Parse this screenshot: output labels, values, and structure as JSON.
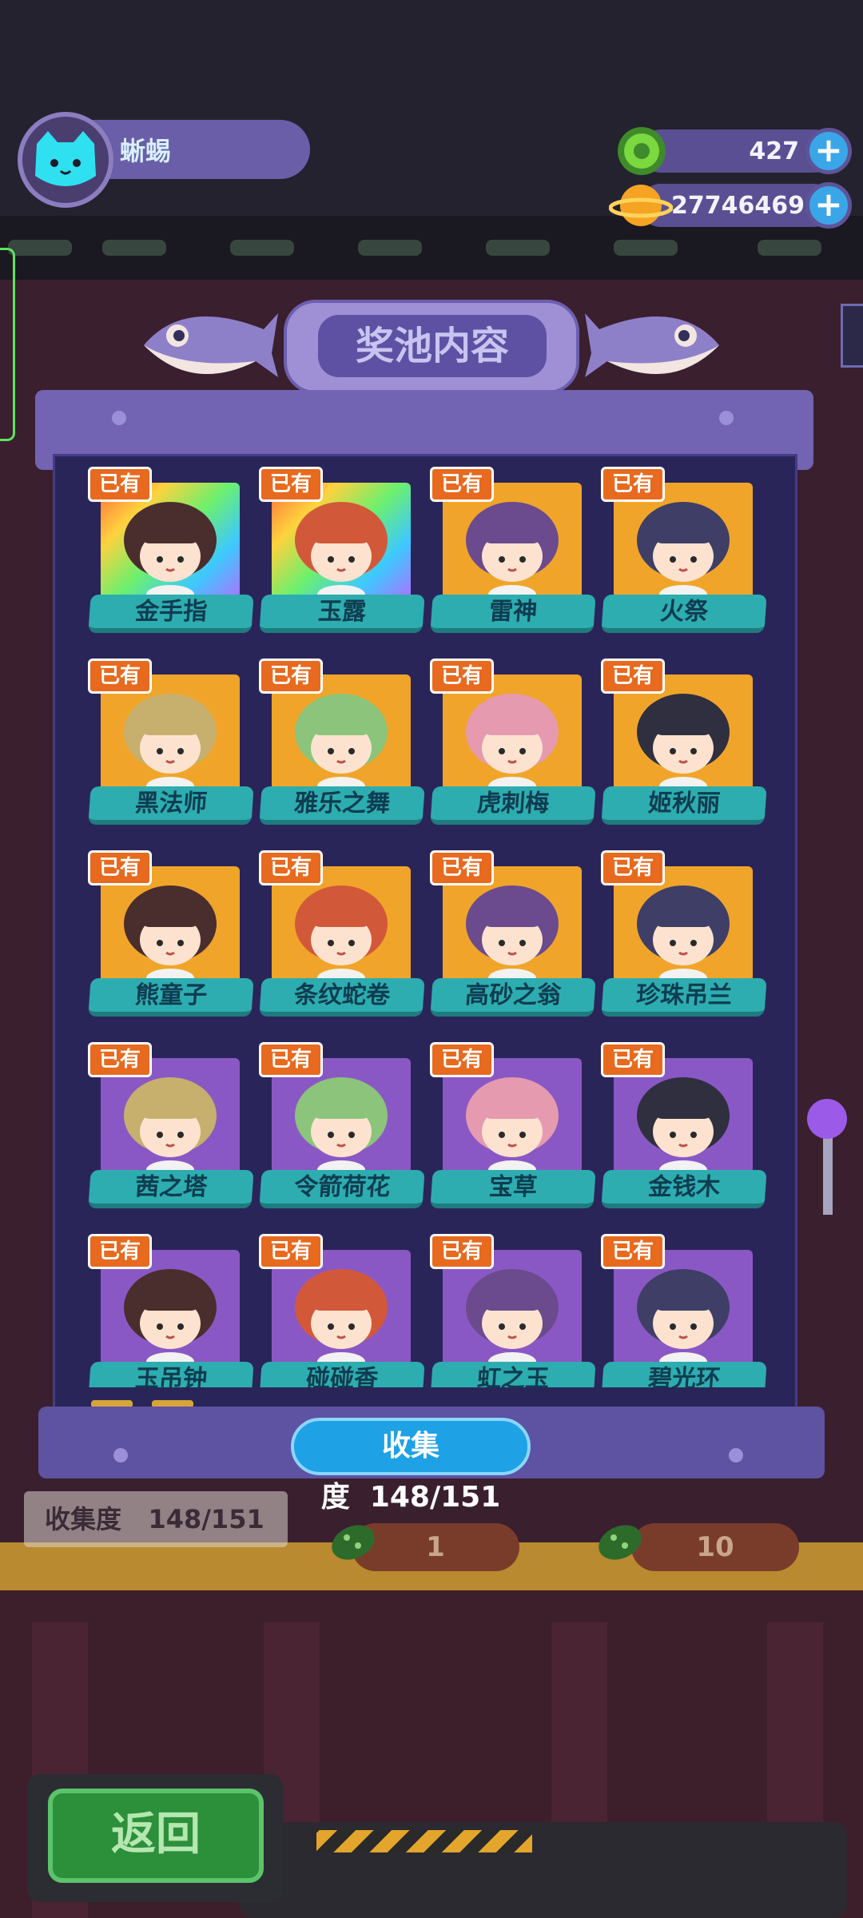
{
  "player": {
    "name": "蜥蜴"
  },
  "currency": {
    "coins": {
      "icon": "green-coin-icon",
      "value": "427"
    },
    "planets": {
      "icon": "planet-icon",
      "value": "27746469"
    }
  },
  "dialog": {
    "title": "奖池内容",
    "progress_label": "收集度",
    "progress_value": "148/151",
    "owned_badge": "已有",
    "items": [
      {
        "name": "金手指",
        "tier": "rainbow"
      },
      {
        "name": "玉露",
        "tier": "rainbow"
      },
      {
        "name": "雷神",
        "tier": "gold"
      },
      {
        "name": "火祭",
        "tier": "gold"
      },
      {
        "name": "黑法师",
        "tier": "gold"
      },
      {
        "name": "雅乐之舞",
        "tier": "gold"
      },
      {
        "name": "虎刺梅",
        "tier": "gold"
      },
      {
        "name": "姬秋丽",
        "tier": "gold"
      },
      {
        "name": "熊童子",
        "tier": "gold"
      },
      {
        "name": "条纹蛇卷",
        "tier": "gold"
      },
      {
        "name": "高砂之翁",
        "tier": "gold"
      },
      {
        "name": "珍珠吊兰",
        "tier": "gold"
      },
      {
        "name": "茜之塔",
        "tier": "purple"
      },
      {
        "name": "令箭荷花",
        "tier": "purple"
      },
      {
        "name": "宝草",
        "tier": "purple"
      },
      {
        "name": "金钱木",
        "tier": "purple"
      },
      {
        "name": "玉吊钟",
        "tier": "purple"
      },
      {
        "name": "碰碰香",
        "tier": "purple"
      },
      {
        "name": "虹之玉",
        "tier": "purple"
      },
      {
        "name": "碧光环",
        "tier": "purple"
      }
    ]
  },
  "background": {
    "stat_label": "收集度",
    "stat_value": "148/151",
    "draw_one": "1",
    "draw_ten": "10",
    "back_label": "返回"
  },
  "colors": {
    "panel": "#2a2559",
    "frame": "#7264b2",
    "name_tag": "#2dadb0",
    "owned_badge": "#e76a1f",
    "progress_pill": "#1fa1e6",
    "gold_card": "#f0a52a",
    "purple_card": "#8a58c4"
  }
}
